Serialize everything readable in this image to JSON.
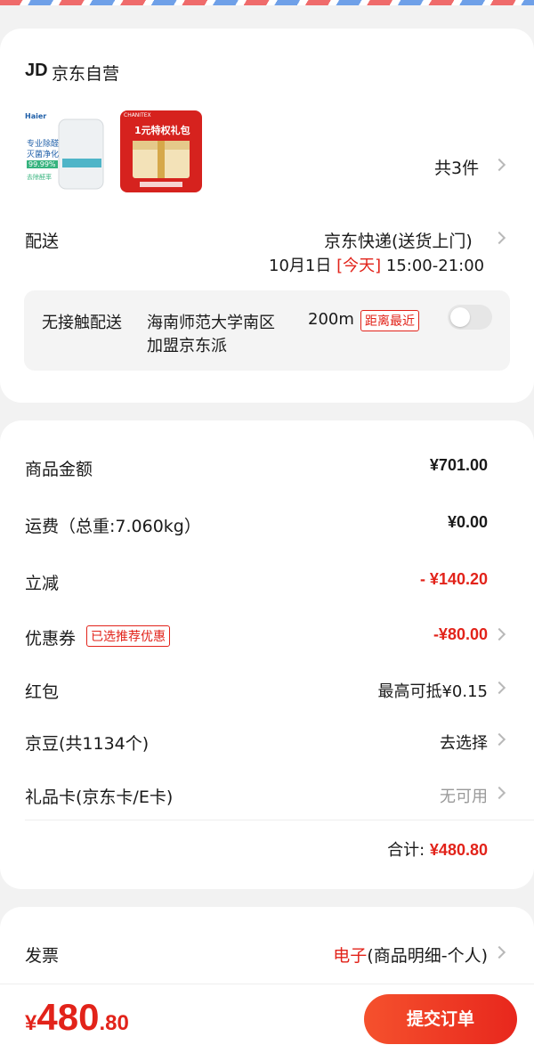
{
  "store": {
    "logo_text": "JD",
    "name": "京东自营"
  },
  "products": {
    "item1": {
      "brand": "Haier",
      "line1": "专业除醛",
      "line2": "灭菌净化",
      "percent": "99.99%",
      "caption": "去除醛率"
    },
    "item2": {
      "brand": "CHANITEX",
      "title": "1元特权礼包"
    },
    "count_label": "共3件"
  },
  "delivery": {
    "label": "配送",
    "method": "京东快递(送货上门)",
    "date": "10月1日",
    "today_tag": "[今天]",
    "time": "15:00-21:00",
    "contactless": {
      "label": "无接触配送",
      "location_line1": "海南师范大学南区",
      "location_line2": "加盟京东派",
      "distance": "200m",
      "nearest_tag": "距离最近",
      "enabled": false
    }
  },
  "pricing": {
    "goods_amount": {
      "label": "商品金额",
      "value": "¥701.00"
    },
    "shipping": {
      "label": "运费（总重:7.060kg）",
      "value": "¥0.00"
    },
    "instant_discount": {
      "label": "立减",
      "value": "- ¥140.20"
    },
    "coupon": {
      "label": "优惠券",
      "tag": "已选推荐优惠",
      "value": "-¥80.00"
    },
    "red_packet": {
      "label": "红包",
      "value": "最高可抵¥0.15"
    },
    "jingdou": {
      "label": "京豆(共1134个)",
      "value": "去选择"
    },
    "gift_card": {
      "label": "礼品卡(京东卡/E卡)",
      "value": "无可用"
    },
    "total": {
      "label": "合计:",
      "value": "¥480.80"
    }
  },
  "invoice": {
    "label": "发票",
    "type_highlight": "电子",
    "detail": "(商品明细-个人)"
  },
  "footer": {
    "currency": "¥",
    "amount_int": "480",
    "amount_dec": ".80",
    "submit_label": "提交订单"
  },
  "colors": {
    "accent": "#e2231a",
    "background": "#f2f2f2",
    "card": "#ffffff"
  }
}
